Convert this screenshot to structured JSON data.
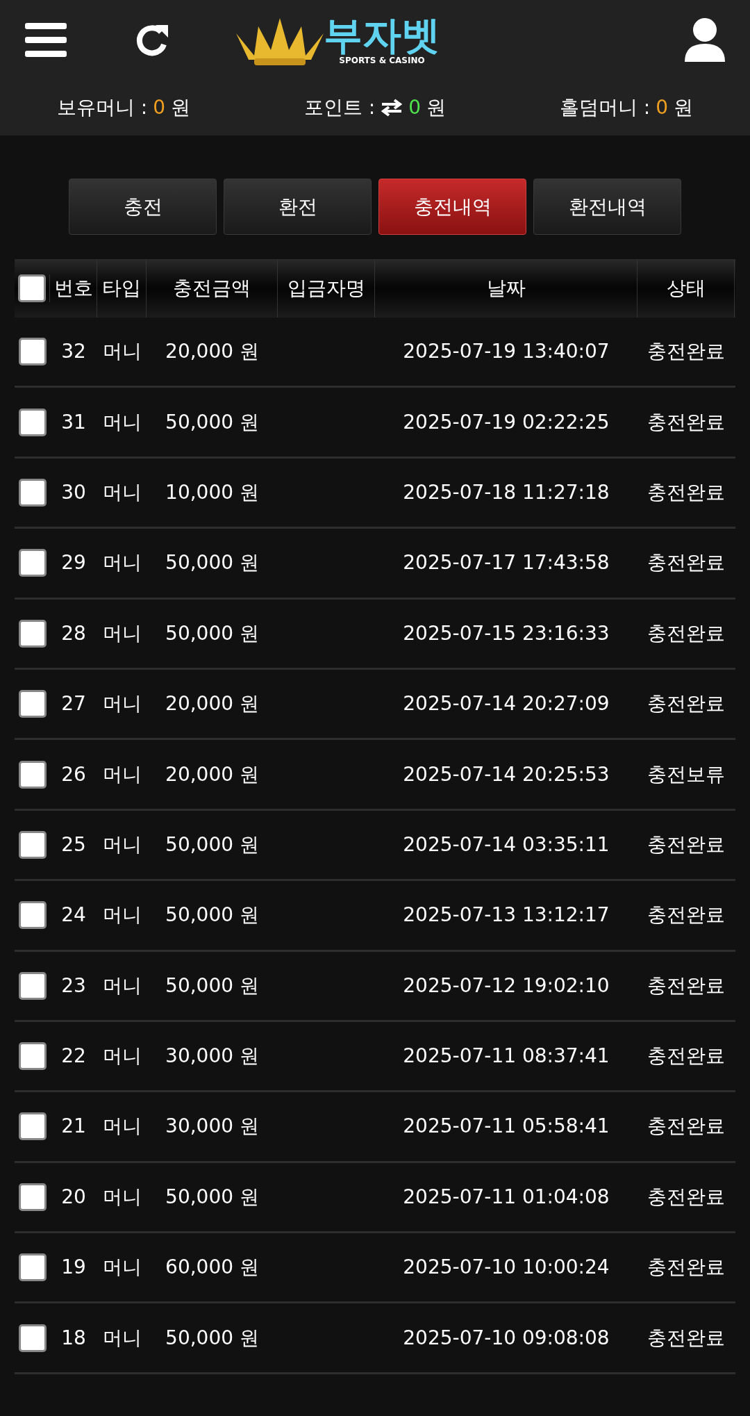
{
  "header": {
    "logo_title": "부자벳",
    "logo_subtitle": "SPORTS & CASINO"
  },
  "balances": [
    {
      "kind": "money",
      "label": "보유머니 :",
      "value": "0",
      "unit": "원"
    },
    {
      "kind": "point",
      "label": "포인트 :",
      "value": "0",
      "unit": "원"
    },
    {
      "kind": "money",
      "label": "홀덤머니 :",
      "value": "0",
      "unit": "원"
    }
  ],
  "tabs": [
    {
      "label": "충전",
      "selected": false
    },
    {
      "label": "환전",
      "selected": false
    },
    {
      "label": "충전내역",
      "selected": true
    },
    {
      "label": "환전내역",
      "selected": false
    }
  ],
  "table": {
    "all_checked": false,
    "columns": [
      "번호",
      "타입",
      "충전금액",
      "입금자명",
      "날짜",
      "상태"
    ],
    "rows": [
      {
        "checked": false,
        "no": "32",
        "type": "머니",
        "amount": "20,000 원",
        "date": "2025-07-19 13:40:07",
        "status": "충전완료"
      },
      {
        "checked": false,
        "no": "31",
        "type": "머니",
        "amount": "50,000 원",
        "date": "2025-07-19 02:22:25",
        "status": "충전완료"
      },
      {
        "checked": false,
        "no": "30",
        "type": "머니",
        "amount": "10,000 원",
        "date": "2025-07-18 11:27:18",
        "status": "충전완료"
      },
      {
        "checked": false,
        "no": "29",
        "type": "머니",
        "amount": "50,000 원",
        "date": "2025-07-17 17:43:58",
        "status": "충전완료"
      },
      {
        "checked": false,
        "no": "28",
        "type": "머니",
        "amount": "50,000 원",
        "date": "2025-07-15 23:16:33",
        "status": "충전완료"
      },
      {
        "checked": false,
        "no": "27",
        "type": "머니",
        "amount": "20,000 원",
        "date": "2025-07-14 20:27:09",
        "status": "충전완료"
      },
      {
        "checked": false,
        "no": "26",
        "type": "머니",
        "amount": "20,000 원",
        "date": "2025-07-14 20:25:53",
        "status": "충전보류"
      },
      {
        "checked": false,
        "no": "25",
        "type": "머니",
        "amount": "50,000 원",
        "date": "2025-07-14 03:35:11",
        "status": "충전완료"
      },
      {
        "checked": false,
        "no": "24",
        "type": "머니",
        "amount": "50,000 원",
        "date": "2025-07-13 13:12:17",
        "status": "충전완료"
      },
      {
        "checked": false,
        "no": "23",
        "type": "머니",
        "amount": "50,000 원",
        "date": "2025-07-12 19:02:10",
        "status": "충전완료"
      },
      {
        "checked": false,
        "no": "22",
        "type": "머니",
        "amount": "30,000 원",
        "date": "2025-07-11 08:37:41",
        "status": "충전완료"
      },
      {
        "checked": false,
        "no": "21",
        "type": "머니",
        "amount": "30,000 원",
        "date": "2025-07-11 05:58:41",
        "status": "충전완료"
      },
      {
        "checked": false,
        "no": "20",
        "type": "머니",
        "amount": "50,000 원",
        "date": "2025-07-11 01:04:08",
        "status": "충전완료"
      },
      {
        "checked": false,
        "no": "19",
        "type": "머니",
        "amount": "60,000 원",
        "date": "2025-07-10 10:00:24",
        "status": "충전완료"
      },
      {
        "checked": false,
        "no": "18",
        "type": "머니",
        "amount": "50,000 원",
        "date": "2025-07-10 09:08:08",
        "status": "충전완료"
      }
    ]
  }
}
